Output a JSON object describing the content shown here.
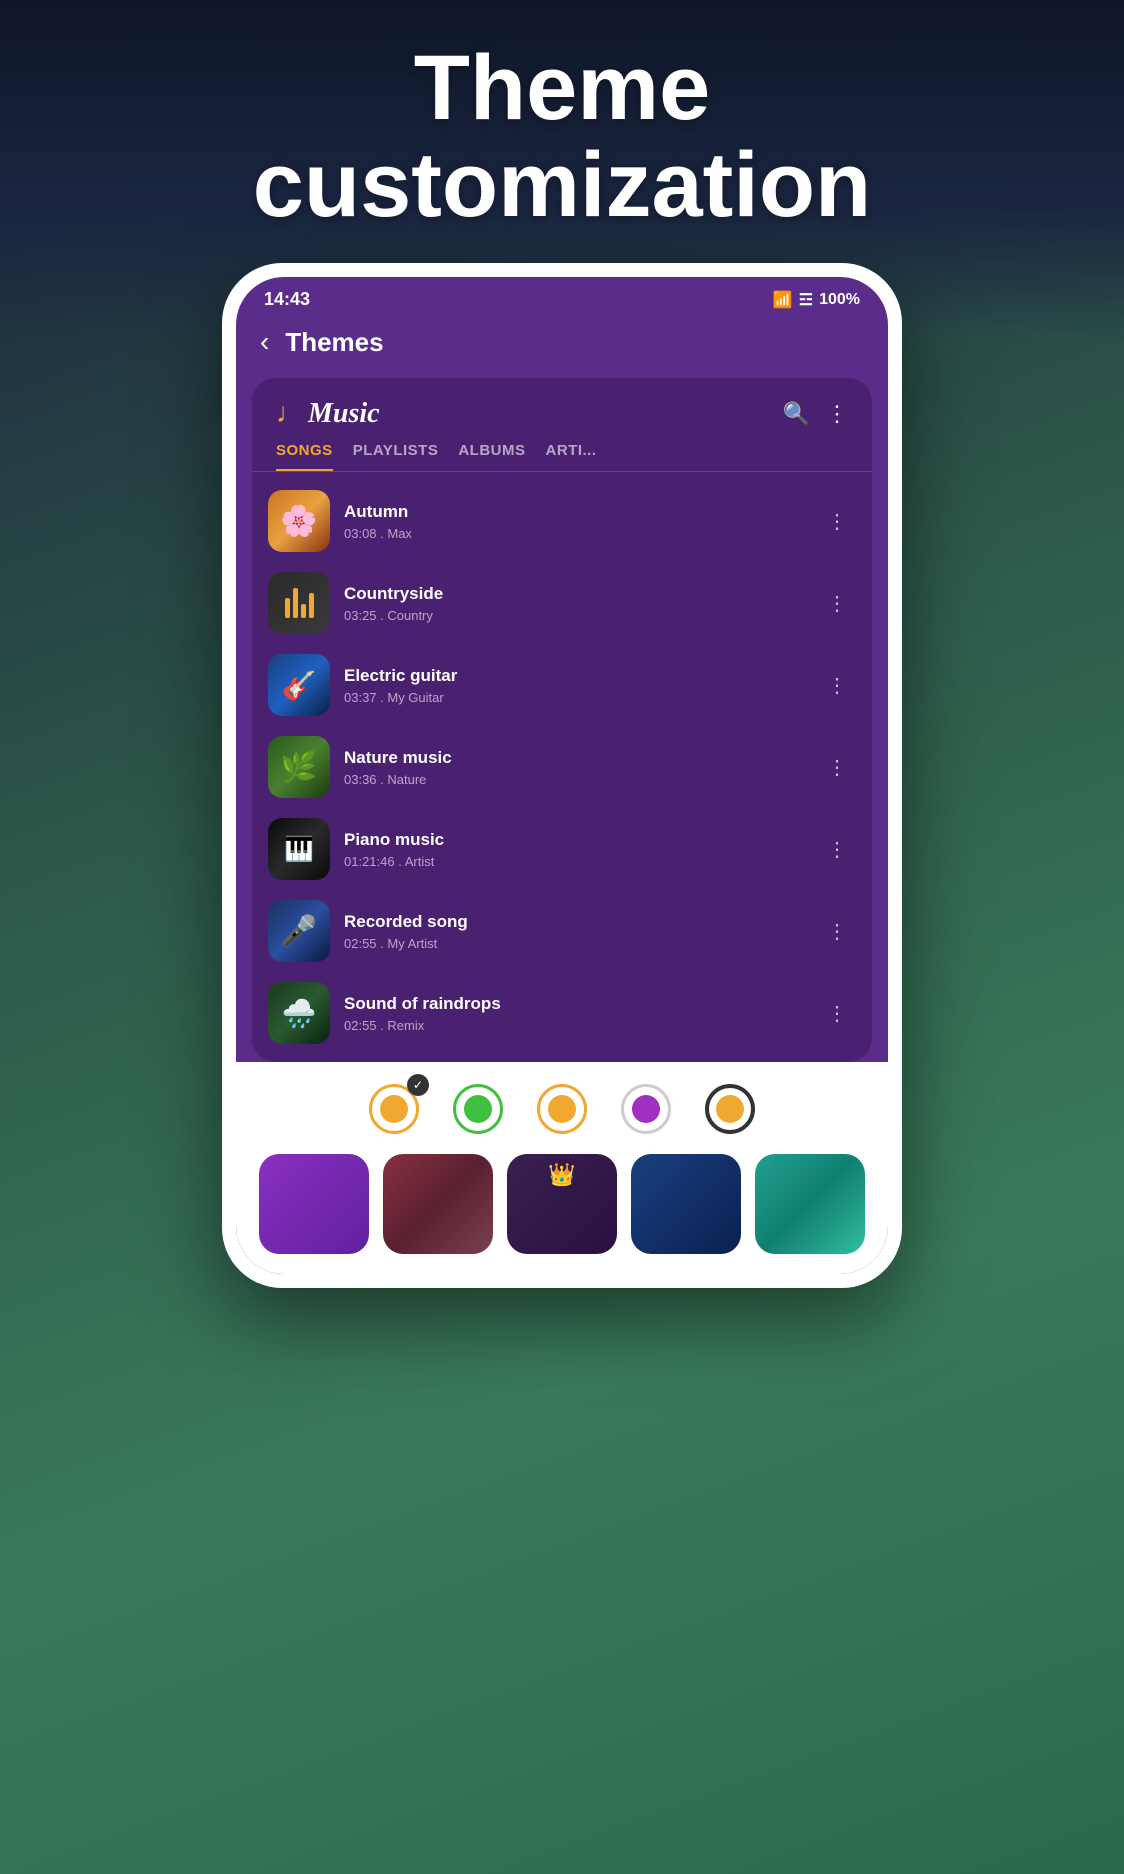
{
  "page": {
    "title_line1": "Theme",
    "title_line2": "customization"
  },
  "status_bar": {
    "time": "14:43",
    "battery": "100%"
  },
  "app_nav": {
    "back_label": "‹",
    "title": "Themes"
  },
  "music_app": {
    "logo": "Music",
    "tabs": [
      {
        "label": "SONGS",
        "active": true
      },
      {
        "label": "PLAYLISTS",
        "active": false
      },
      {
        "label": "ALBUMS",
        "active": false
      },
      {
        "label": "ARTI...",
        "active": false
      }
    ],
    "songs": [
      {
        "name": "Autumn",
        "duration": "03:08",
        "artist": "Max",
        "thumb_type": "autumn"
      },
      {
        "name": "Countryside",
        "duration": "03:25",
        "artist": "Country",
        "thumb_type": "countryside"
      },
      {
        "name": "Electric guitar",
        "duration": "03:37",
        "artist": "My Guitar",
        "thumb_type": "electric"
      },
      {
        "name": "Nature music",
        "duration": "03:36",
        "artist": "Nature",
        "thumb_type": "nature"
      },
      {
        "name": "Piano music",
        "duration": "01:21:46",
        "artist": "Artist",
        "thumb_type": "piano"
      },
      {
        "name": "Recorded song",
        "duration": "02:55",
        "artist": "My Artist",
        "thumb_type": "recorded"
      },
      {
        "name": "Sound of raindrops",
        "duration": "02:55",
        "artist": "Remix",
        "thumb_type": "raindrops"
      }
    ]
  },
  "theme_dots": [
    {
      "color": "#f0a830",
      "border": "#f0a830",
      "selected": true
    },
    {
      "color": "#40c040",
      "border": "#40c040",
      "selected": false
    },
    {
      "color": "#f0a830",
      "border": "#f0a830",
      "selected": false
    },
    {
      "color": "#a030c0",
      "border": "#ccc",
      "selected": false
    },
    {
      "color": "#f0a830",
      "border": "#ccc",
      "selected": false
    }
  ],
  "theme_swatches": [
    {
      "type": "purple",
      "has_crown": false
    },
    {
      "type": "red",
      "has_crown": false
    },
    {
      "type": "dark",
      "has_crown": true
    },
    {
      "type": "blue",
      "has_crown": false
    },
    {
      "type": "teal",
      "has_crown": false
    }
  ]
}
